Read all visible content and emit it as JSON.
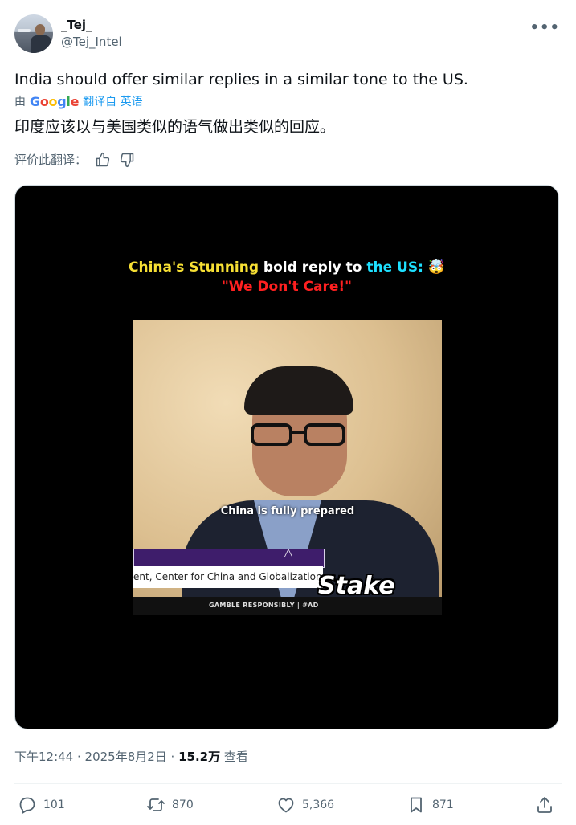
{
  "author": {
    "display_name": "_Tej_",
    "handle": "@Tej_Intel"
  },
  "menu_icon": "more-icon",
  "tweet": {
    "text": "India should offer similar replies in a similar tone to the US.",
    "translated_by_prefix": "由",
    "translate_source": "翻译自 英语",
    "translated_text": "印度应该以与美国类似的语气做出类似的回应。",
    "rate_label": "评价此翻译："
  },
  "media": {
    "caption_part1": "China's Stunning",
    "caption_part2": " bold reply to ",
    "caption_part3": "the US:",
    "caption_emoji": "🤯",
    "caption_line2": "\"We Don't Care!\"",
    "subtitle": "China is fully prepared",
    "lower_third": "ent, Center for China and Globalization",
    "brand": "Stake",
    "disclaimer": "GAMBLE RESPONSIBLY  |  #AD"
  },
  "meta": {
    "time": "下午12:44 · 2025年8月2日 · ",
    "views": "15.2万",
    "views_label": " 查看"
  },
  "actions": {
    "replies": "101",
    "reposts": "870",
    "likes": "5,366",
    "bookmarks": "871"
  },
  "colors": {
    "accent": "#1d9bf0",
    "muted": "#536471",
    "text": "#0f1419"
  }
}
